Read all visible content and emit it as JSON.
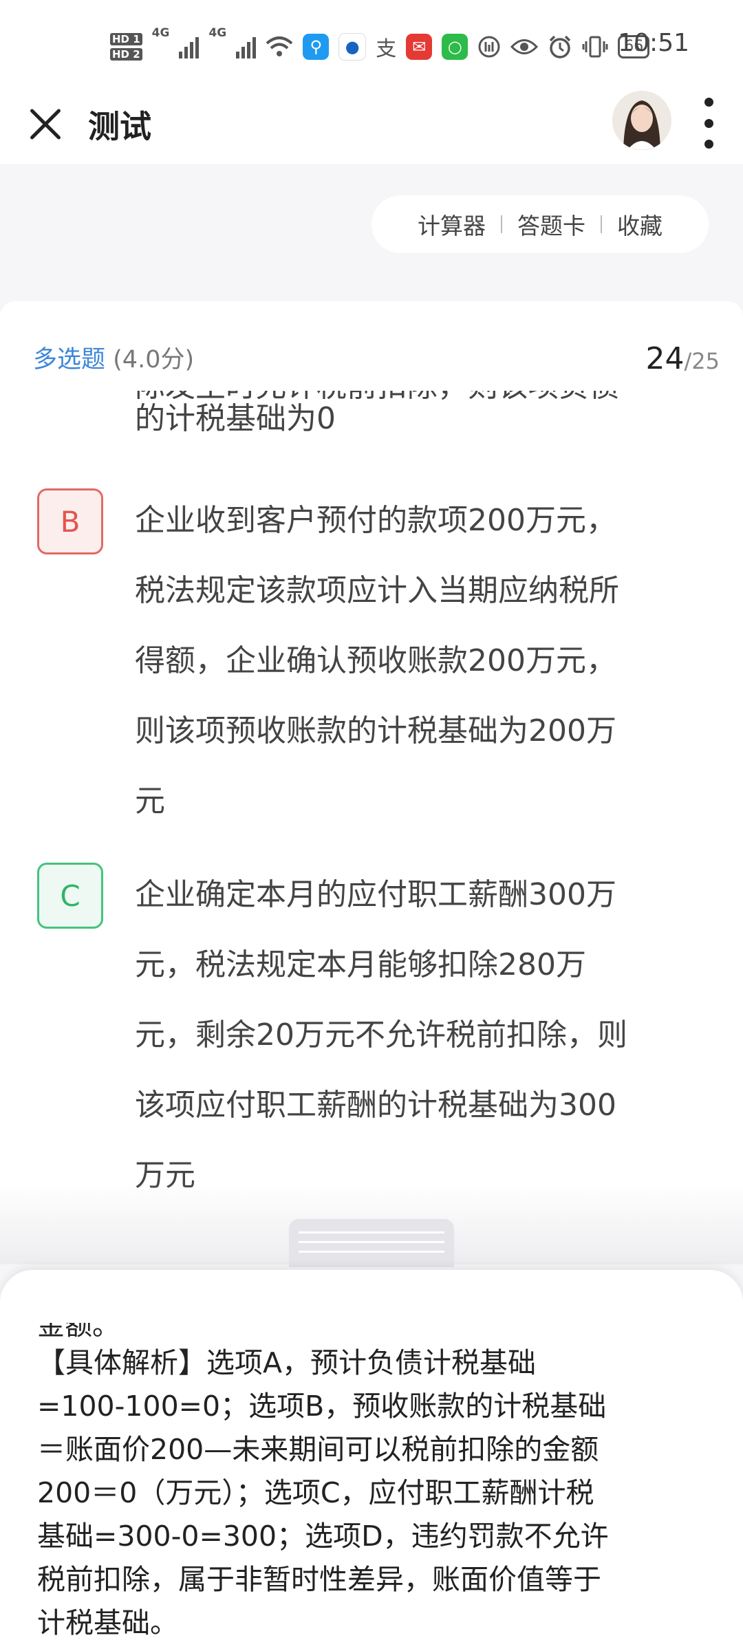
{
  "status_bar": {
    "hd1": "HD 1",
    "hd2": "HD 2",
    "net1": "4G",
    "net2": "4G",
    "battery": "66",
    "time": "10:51"
  },
  "header": {
    "title": "测试",
    "close_icon": "close-icon",
    "more_icon": "more-vertical-icon"
  },
  "toolbar": {
    "calculator": "计算器",
    "answer_sheet": "答题卡",
    "favorite": "收藏"
  },
  "question": {
    "type": "多选题",
    "score": "(4.0分)",
    "current": "24",
    "total": "/25",
    "partial_line": "际发生时允许税前扣除，则该项负债",
    "option_a_tail": "的计税基础为0",
    "options": [
      {
        "letter": "B",
        "lines": [
          "企业收到客户预付的款项200万元，",
          "税法规定该款项应计入当期应纳税所",
          "得额，企业确认预收账款200万元，",
          "则该项预收账款的计税基础为200万",
          "元"
        ]
      },
      {
        "letter": "C",
        "lines": [
          "企业确定本月的应付职工薪酬300万",
          "元，税法规定本月能够扣除280万",
          "元，剩余20万元不允许税前扣除，则",
          "该项应付职工薪酬的计税基础为300",
          "万元"
        ]
      }
    ]
  },
  "analysis": {
    "cut_line": "金额。",
    "lines": [
      "【具体解析】选项A，预计负债计税基础",
      "=100-100=0；选项B，预收账款的计税基础",
      "＝账面价200—未来期间可以税前扣除的金额",
      "200＝0（万元）；选项C，应付职工薪酬计税",
      "基础=300-0=300；选项D，违约罚款不允许",
      "税前扣除，属于非暂时性差异，账面价值等于",
      "计税基础。"
    ]
  },
  "colors": {
    "accent_blue": "#3c86d8",
    "option_b_red": "#e2564f",
    "option_c_green": "#2fb36d"
  }
}
